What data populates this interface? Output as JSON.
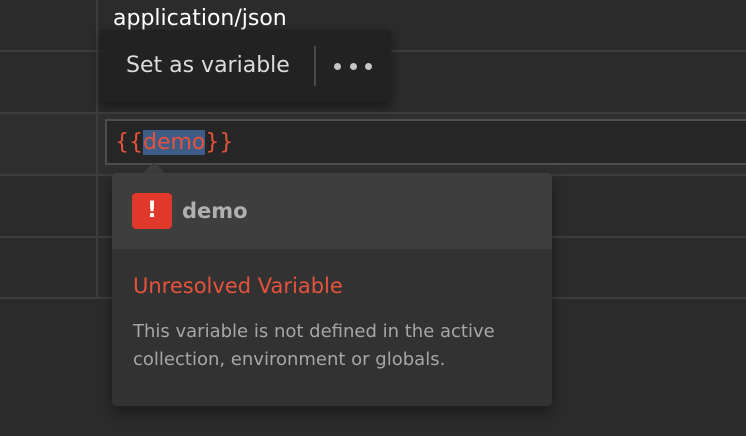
{
  "table": {
    "content_type_value": "application/json"
  },
  "var_menu": {
    "set_as_variable_label": "Set as variable",
    "more_label": "•••"
  },
  "value_input": {
    "prefix": "{{",
    "selected_text": "demo",
    "suffix": "}}"
  },
  "tooltip": {
    "icon_glyph": "!",
    "icon_name": "error-icon",
    "variable_name": "demo",
    "title": "Unresolved Variable",
    "description": "This variable is not defined in the active collection, environment or globals."
  },
  "colors": {
    "error_red": "#e5533c",
    "icon_red": "#e0382a",
    "selection_blue": "#3f5c86",
    "background": "#2b2b2b"
  }
}
